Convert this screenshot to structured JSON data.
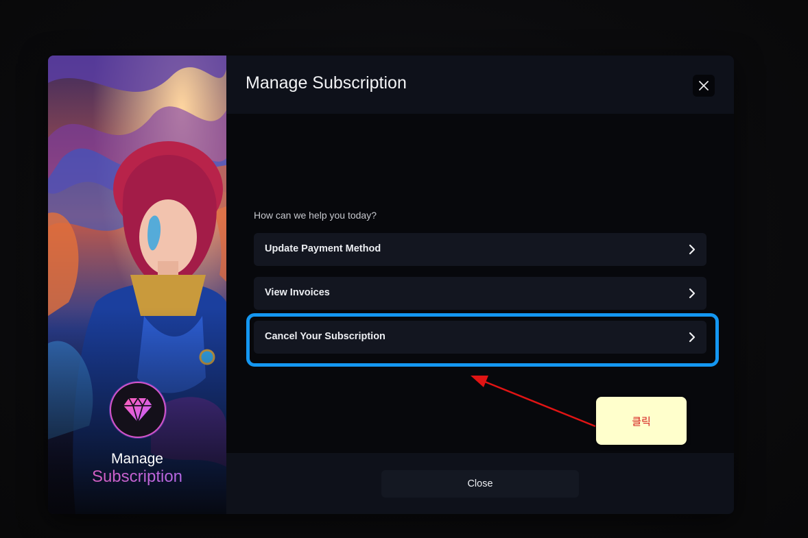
{
  "modal": {
    "title": "Manage Subscription",
    "close_icon": "close-icon",
    "prompt": "How can we help you today?",
    "options": [
      {
        "label": "Update Payment Method",
        "icon": "chevron-right-icon"
      },
      {
        "label": "View Invoices",
        "icon": "chevron-right-icon"
      },
      {
        "label": "Cancel Your Subscription",
        "icon": "chevron-right-icon"
      }
    ],
    "footer": {
      "close_label": "Close"
    }
  },
  "art_panel": {
    "badge_icon": "diamond-icon",
    "title_line1": "Manage",
    "title_line2": "Subscription"
  },
  "annotation": {
    "note_text": "클릭",
    "highlight_color": "#1497f2",
    "arrow_color": "#e01414",
    "note_color": "#ffffcc"
  },
  "colors": {
    "page_background": "#0b0b0d",
    "modal_background": "#07080c",
    "header_background": "#0e111a",
    "option_background": "#131620",
    "accent_pink": "#e35ab0",
    "accent_purple": "#a46cf5"
  }
}
